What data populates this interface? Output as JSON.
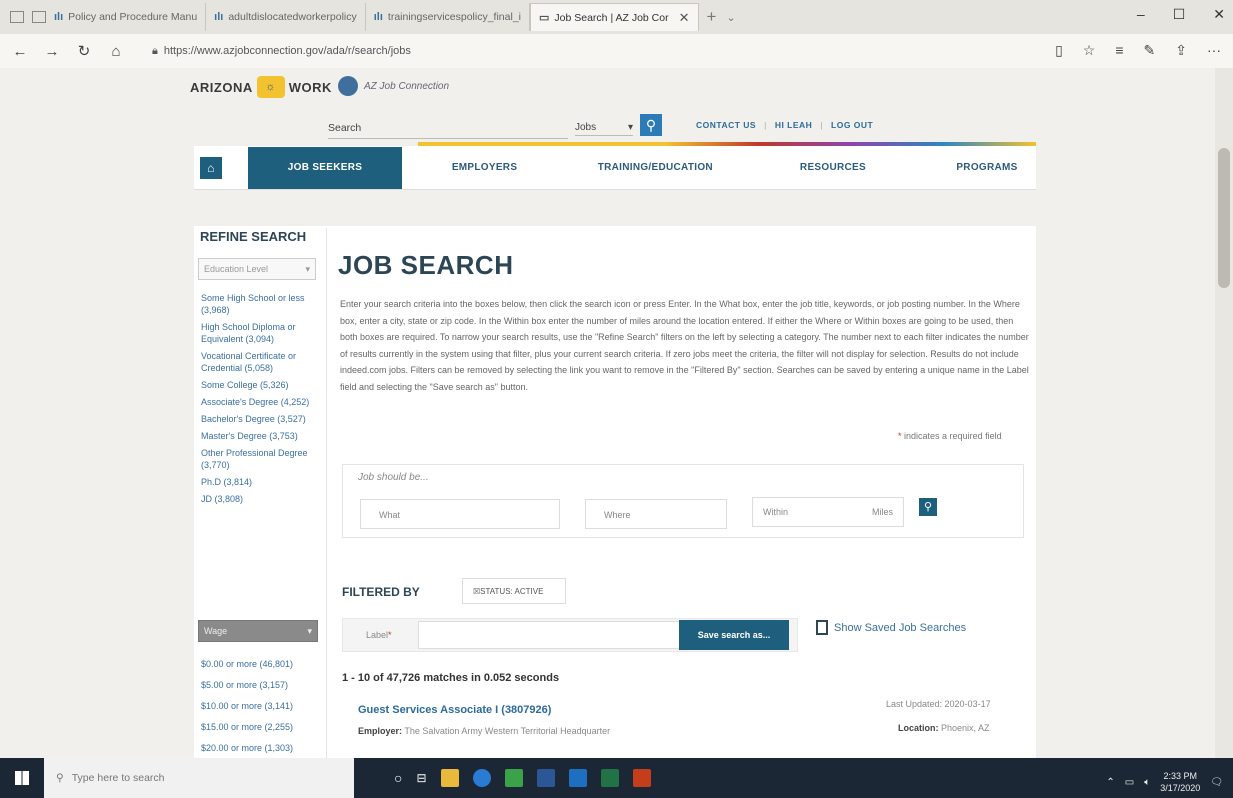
{
  "browser": {
    "tabs": [
      {
        "label": "Policy and Procedure Manu"
      },
      {
        "label": "adultdislocatedworkerpolicy"
      },
      {
        "label": "trainingservicespolicy_final_i"
      }
    ],
    "active_tab": {
      "label": "Job Search | AZ Job Cor",
      "close": "✕"
    },
    "new_tab": "+",
    "url": "https://www.azjobconnection.gov/ada/r/search/jobs"
  },
  "site": {
    "logo": "ARIZONA",
    "logo_work": "WORK",
    "logo2": "AZ Job Connection",
    "search_label": "Search",
    "search_scope": "Jobs",
    "top_links": {
      "contact": "CONTACT US",
      "user": "HI LEAH",
      "logout": "LOG OUT"
    }
  },
  "nav": {
    "job_seekers": "JOB SEEKERS",
    "employers": "EMPLOYERS",
    "training": "TRAINING/EDUCATION",
    "resources": "RESOURCES",
    "programs": "PROGRAMS"
  },
  "sidebar": {
    "title": "REFINE SEARCH",
    "education_select": "Education Level",
    "education_items": [
      {
        "label": "Some High School or less (3,968)"
      },
      {
        "label": "High School Diploma or Equivalent (3,094)"
      },
      {
        "label": "Vocational Certificate or Credential (5,058)"
      },
      {
        "label": "Some College (5,326)"
      },
      {
        "label": "Associate's Degree (4,252)"
      },
      {
        "label": "Bachelor's Degree (3,527)"
      },
      {
        "label": "Master's Degree (3,753)"
      },
      {
        "label": "Other Professional Degree (3,770)"
      },
      {
        "label": "Ph.D (3,814)"
      },
      {
        "label": "JD (3,808)"
      }
    ],
    "wage_select": "Wage",
    "wage_items": [
      {
        "label": "$0.00 or more (46,801)"
      },
      {
        "label": "$5.00 or more (3,157)"
      },
      {
        "label": "$10.00 or more (3,141)"
      },
      {
        "label": "$15.00 or more (2,255)"
      },
      {
        "label": "$20.00 or more (1,303)"
      }
    ]
  },
  "main": {
    "title": "JOB SEARCH",
    "intro": "Enter your search criteria into the boxes below, then click the search icon or press Enter. In the What box, enter the job title, keywords, or job posting number. In the Where box, enter a city, state or zip code. In the Within box enter the number of miles around the location entered. If either the Where or Within boxes are going to be used, then both boxes are required. To narrow your search results, use the \"Refine Search\" filters on the left by selecting a category. The number next to each filter indicates the number of results currently in the system using that filter, plus your current search criteria. If zero jobs meet the criteria, the filter will not display for selection. Results do not include indeed.com jobs. Filters can be removed by selecting the link you want to remove in the \"Filtered By\" section. Searches can be saved by entering a unique name in the Label field and selecting the \"Save search as\" button.",
    "required_note": "indicates a required field",
    "required_star": "*",
    "search_box_label": "Job should be...",
    "what_placeholder": "What",
    "where_placeholder": "Where",
    "within_placeholder": "Within",
    "miles_label": "Miles",
    "filtered_by": "FILTERED BY",
    "filter_chip": "☒STATUS: ACTIVE",
    "label_field": "Label",
    "save_button": "Save search as...",
    "saved_searches": "Show Saved Job Searches",
    "matches": "1 - 10 of 47,726 matches in 0.052 seconds",
    "job": {
      "title": "Guest Services Associate I (3807926)",
      "employer_label": "Employer:",
      "employer": "The Salvation Army Western Territorial Headquarter",
      "updated": "Last Updated: 2020-03-17",
      "location_label": "Location:",
      "location": "Phoenix, AZ"
    }
  },
  "taskbar": {
    "search_placeholder": "Type here to search",
    "time": "2:33 PM",
    "date": "3/17/2020"
  },
  "colors": {
    "primary": "#1f5f7e",
    "link": "#3a6fa0",
    "heading": "#2d4656",
    "accent": "#f2c230"
  }
}
